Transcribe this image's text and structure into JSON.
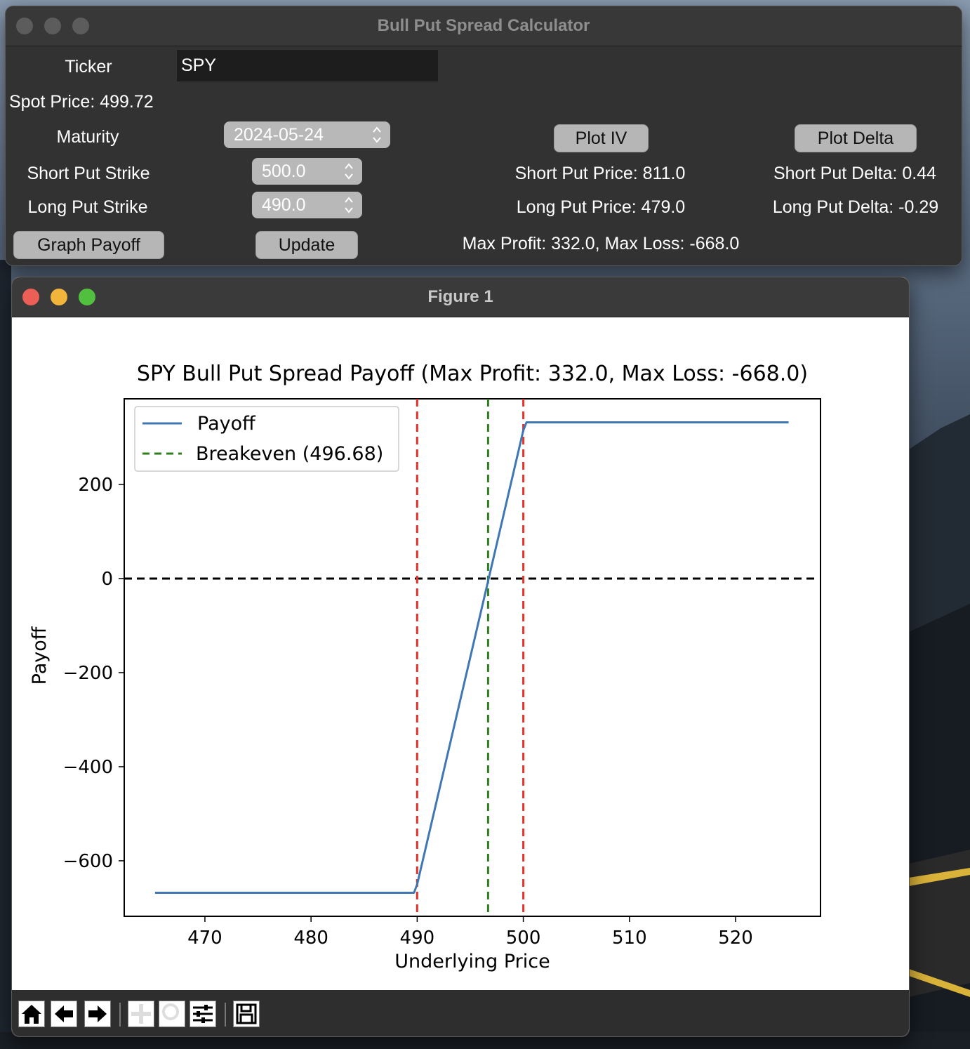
{
  "calculator": {
    "window_title": "Bull Put Spread Calculator",
    "ticker_label": "Ticker",
    "ticker_value": "SPY",
    "spot_price_text": "Spot Price: 499.72",
    "maturity_label": "Maturity",
    "maturity_value": "2024-05-24",
    "short_strike_label": "Short Put Strike",
    "short_strike_value": "500.0",
    "long_strike_label": "Long Put Strike",
    "long_strike_value": "490.0",
    "graph_payoff_button": "Graph Payoff",
    "update_button": "Update",
    "plot_iv_button": "Plot IV",
    "plot_delta_button": "Plot Delta",
    "short_put_price_text": "Short Put Price: 811.0",
    "long_put_price_text": "Long Put Price: 479.0",
    "short_put_delta_text": "Short Put Delta: 0.44",
    "long_put_delta_text": "Long Put Delta: -0.29",
    "max_text": "Max Profit: 332.0, Max Loss: -668.0"
  },
  "figure": {
    "window_title": "Figure 1",
    "toolbar_icons": [
      "home-icon",
      "back-arrow-icon",
      "forward-arrow-icon",
      "pan-icon",
      "zoom-icon",
      "configure-subplots-icon",
      "save-icon"
    ]
  },
  "chart_data": {
    "type": "line",
    "title": "SPY Bull Put Spread Payoff (Max Profit: 332.0, Max Loss: -668.0)",
    "xlabel": "Underlying Price",
    "ylabel": "Payoff",
    "xlim": [
      462.4,
      528.0
    ],
    "ylim": [
      -718,
      382
    ],
    "xticks": [
      470,
      480,
      490,
      500,
      510,
      520
    ],
    "yticks": [
      -600,
      -400,
      -200,
      0,
      200
    ],
    "ytick_labels": [
      "−600",
      "−400",
      "−200",
      "0",
      "200"
    ],
    "grid": false,
    "legend_position": "upper-left",
    "series": [
      {
        "name": "Payoff",
        "color": "#3f77b4",
        "style": "solid",
        "x": [
          465.3,
          489.7,
          490.0,
          500.0,
          500.3,
          525.0
        ],
        "y": [
          -668,
          -668,
          -650,
          315,
          332,
          332
        ]
      }
    ],
    "reference_lines": [
      {
        "orientation": "vertical",
        "x": 496.68,
        "color": "#2e7d1e",
        "style": "dashed",
        "legend": "Breakeven (496.68)"
      },
      {
        "orientation": "vertical",
        "x": 490.0,
        "color": "#e8322a",
        "style": "dashed"
      },
      {
        "orientation": "vertical",
        "x": 500.0,
        "color": "#e8322a",
        "style": "dashed"
      },
      {
        "orientation": "horizontal",
        "y": 0,
        "color": "#000000",
        "style": "dashed"
      }
    ]
  }
}
